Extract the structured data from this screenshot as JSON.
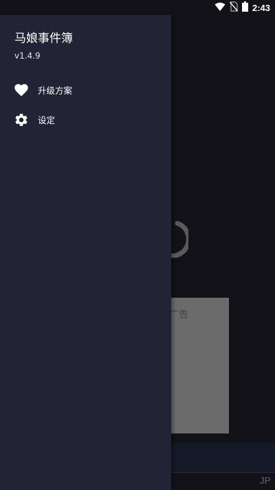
{
  "status_bar": {
    "time": "2:43",
    "icons": [
      "wifi-icon",
      "no-sim-icon",
      "battery-icon"
    ]
  },
  "drawer": {
    "app_title": "马娘事件簿",
    "version": "v1.4.9",
    "menu_items": [
      {
        "label": "升级方案",
        "icon": "heart-icon"
      },
      {
        "label": "设定",
        "icon": "gear-icon"
      }
    ]
  },
  "background": {
    "ad_label": "广告",
    "language_label": "JP"
  },
  "colors": {
    "drawer_bg": "#222436",
    "app_bg": "#121218",
    "ad_box": "#6b6b6b",
    "bottom_bar": "#141a28"
  }
}
